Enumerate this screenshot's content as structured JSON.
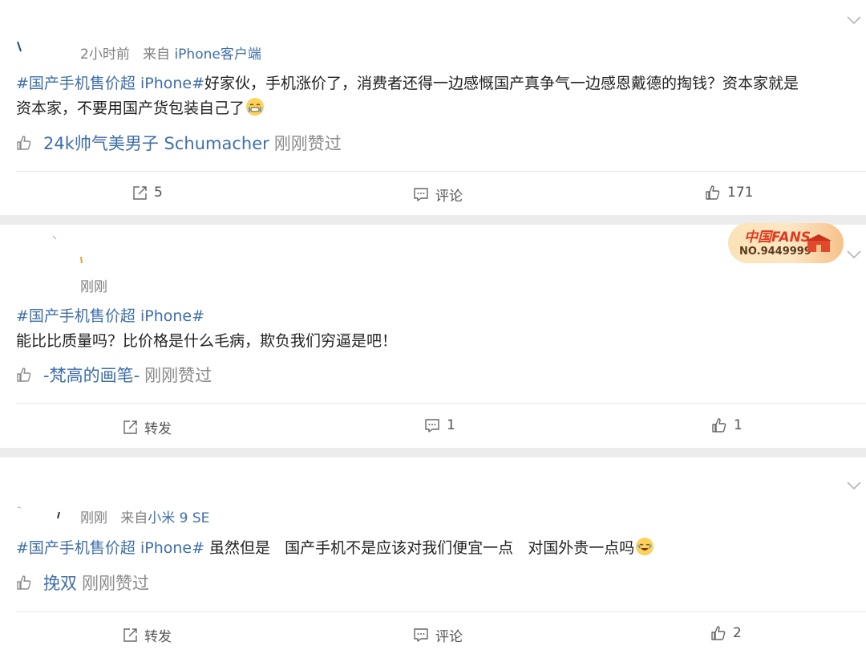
{
  "posts": [
    {
      "meta_time": "2小时前",
      "meta_from": "来自",
      "meta_source": "iPhone客户端",
      "topic": "#国产手机售价超 iPhone#",
      "text": "好家伙，手机涨价了，消费者还得一边感慨国产真争气一边感恩戴德的掏钱？资本家就是",
      "text2": "资本家，不要用国产货包装自己了",
      "liked_by": "24k帅气美男子 Schumacher",
      "liked_suffix": "刚刚赞过",
      "repost": "5",
      "comment": "评论",
      "likes": "171"
    },
    {
      "meta_time": "刚刚",
      "topic": "#国产手机售价超 iPhone#",
      "text": "能比比质量吗？比价格是什么毛病，欺负我们穷逼是吧！",
      "liked_by": "-梵高的画笔-",
      "liked_suffix": "刚刚赞过",
      "repost": "转发",
      "comment": "1",
      "likes": "1",
      "badge_logo": "中国FANS",
      "badge_no": "NO.9449999"
    },
    {
      "meta_time": "刚刚",
      "meta_from": "来自",
      "meta_source": "小米 9 SE",
      "topic": "#国产手机售价超 iPhone#",
      "text": " 虽然但是   国产手机不是应该对我们便宜一点   对国外贵一点吗",
      "liked_by": "挽双",
      "liked_suffix": "刚刚赞过",
      "repost": "转发",
      "comment": "评论",
      "likes": "2"
    }
  ],
  "icons": {
    "like": "thumbs-up-icon",
    "repost": "repost-icon",
    "comment": "comment-icon",
    "more": "chevron-down-icon"
  },
  "colors": {
    "link": "#3e6ea8",
    "muted": "#808080",
    "background": "#ececec"
  }
}
